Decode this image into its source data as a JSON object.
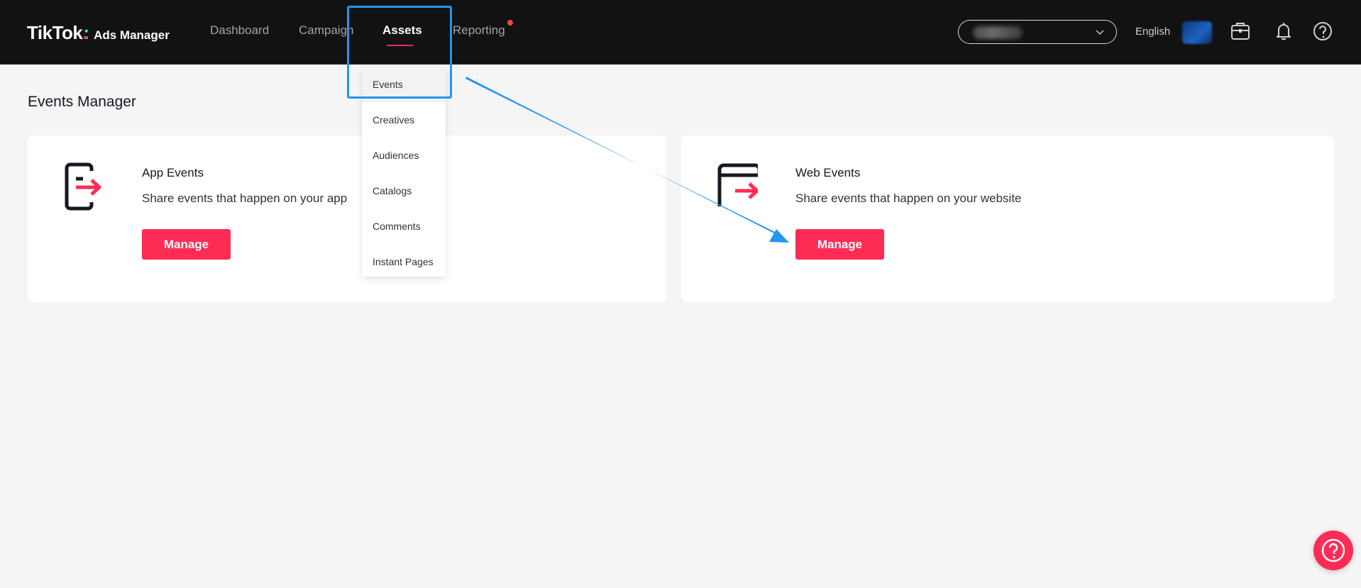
{
  "header": {
    "logo_brand": "TikTok",
    "logo_product": "Ads Manager",
    "nav": [
      {
        "label": "Dashboard"
      },
      {
        "label": "Campaign"
      },
      {
        "label": "Assets"
      },
      {
        "label": "Reporting"
      }
    ],
    "active_nav": "Assets",
    "language": "English"
  },
  "assets_menu": {
    "items": [
      "Events",
      "Creatives",
      "Audiences",
      "Catalogs",
      "Comments",
      "Instant Pages"
    ],
    "highlighted": "Events"
  },
  "page": {
    "title": "Events Manager"
  },
  "cards": [
    {
      "title": "App Events",
      "description": "Share events that happen on your app",
      "button": "Manage"
    },
    {
      "title": "Web Events",
      "description": "Share events that happen on your website",
      "button": "Manage"
    }
  ],
  "colors": {
    "brand_pink": "#fe2c55",
    "header_bg": "#121212",
    "annotation_blue": "#2196f3"
  }
}
